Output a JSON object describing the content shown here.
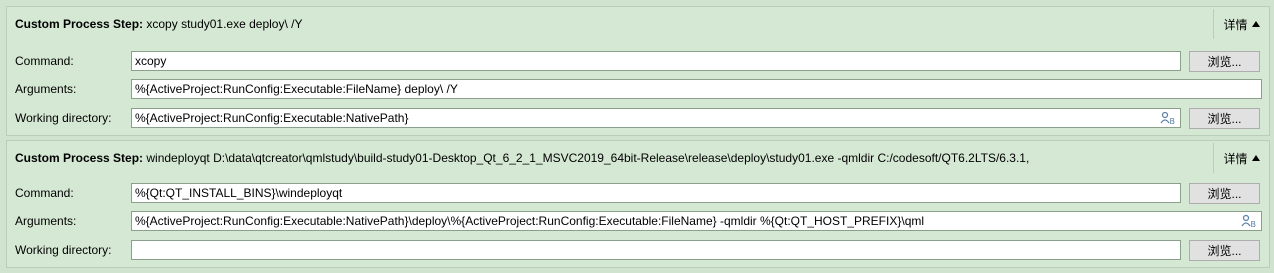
{
  "steps": [
    {
      "header_label": "Custom Process Step:",
      "header_value": " xcopy study01.exe deploy\\ /Y",
      "details_label": "详情",
      "command_label": "Command:",
      "command_value": "xcopy",
      "arguments_label": "Arguments:",
      "arguments_value": "%{ActiveProject:RunConfig:Executable:FileName} deploy\\ /Y",
      "workdir_label": "Working directory:",
      "workdir_value": "%{ActiveProject:RunConfig:Executable:NativePath}",
      "browse_label": "浏览..."
    },
    {
      "header_label": "Custom Process Step:",
      "header_value": " windeployqt D:\\data\\qtcreator\\qmlstudy\\build-study01-Desktop_Qt_6_2_1_MSVC2019_64bit-Release\\release\\deploy\\study01.exe -qmldir C:/codesoft/QT6.2LTS/6.3.1,",
      "details_label": "详情",
      "command_label": "Command:",
      "command_value": "%{Qt:QT_INSTALL_BINS}\\windeployqt",
      "arguments_label": "Arguments:",
      "arguments_value": "%{ActiveProject:RunConfig:Executable:NativePath}\\deploy\\%{ActiveProject:RunConfig:Executable:FileName} -qmldir  %{Qt:QT_HOST_PREFIX}\\qml",
      "workdir_label": "Working directory:",
      "workdir_value": "",
      "browse_label": "浏览..."
    }
  ]
}
